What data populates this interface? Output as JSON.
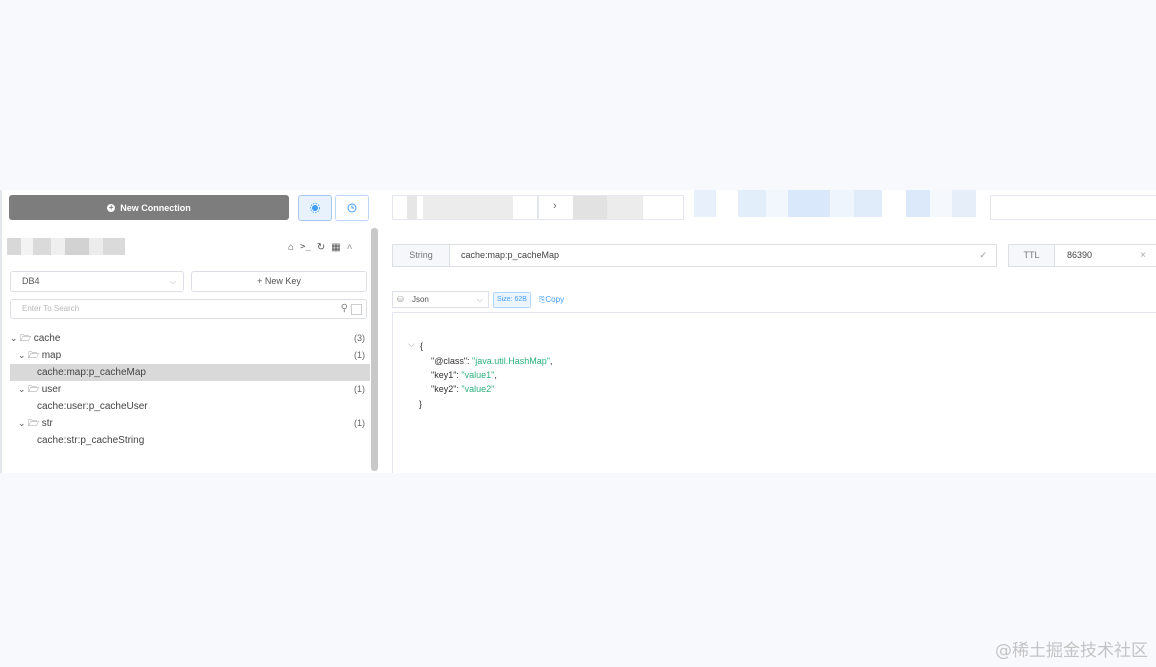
{
  "left": {
    "new_connection_label": "New Connection",
    "db_select_value": "DB4",
    "new_key_label": "+ New Key",
    "search_placeholder": "Enter To Search",
    "tree": [
      {
        "label": "cache",
        "count": "(3)",
        "level": 0,
        "folder": true
      },
      {
        "label": "map",
        "count": "(1)",
        "level": 1,
        "folder": true
      },
      {
        "label": "cache:map:p_cacheMap",
        "level": 2,
        "folder": false,
        "selected": true
      },
      {
        "label": "user",
        "count": "(1)",
        "level": 1,
        "folder": true
      },
      {
        "label": "cache:user:p_cacheUser",
        "level": 2,
        "folder": false
      },
      {
        "label": "str",
        "count": "(1)",
        "level": 1,
        "folder": true
      },
      {
        "label": "cache:str:p_cacheString",
        "level": 2,
        "folder": false
      }
    ]
  },
  "right": {
    "type_label": "String",
    "key_name": "cache:map:p_cacheMap",
    "ttl_label": "TTL",
    "ttl_value": "86390",
    "format_value": "Json",
    "size_badge": "Size: 62B",
    "copy_label": "Copy",
    "json_lines": [
      {
        "prefix": "{",
        "key": "",
        "val": "",
        "suffix": ""
      },
      {
        "prefix": "  ",
        "key": "\"@class\"",
        "val": "\"java.util.HashMap\"",
        "suffix": ","
      },
      {
        "prefix": "  ",
        "key": "\"key1\"",
        "val": "\"value1\"",
        "suffix": ","
      },
      {
        "prefix": "  ",
        "key": "\"key2\"",
        "val": "\"value2\"",
        "suffix": ""
      },
      {
        "prefix": "}",
        "key": "",
        "val": "",
        "suffix": ""
      }
    ]
  },
  "watermark": "@稀土掘金技术社区",
  "colors": {
    "accent": "#409eff",
    "json_string": "#2ab07a",
    "selected_row": "#d9d9d9"
  }
}
